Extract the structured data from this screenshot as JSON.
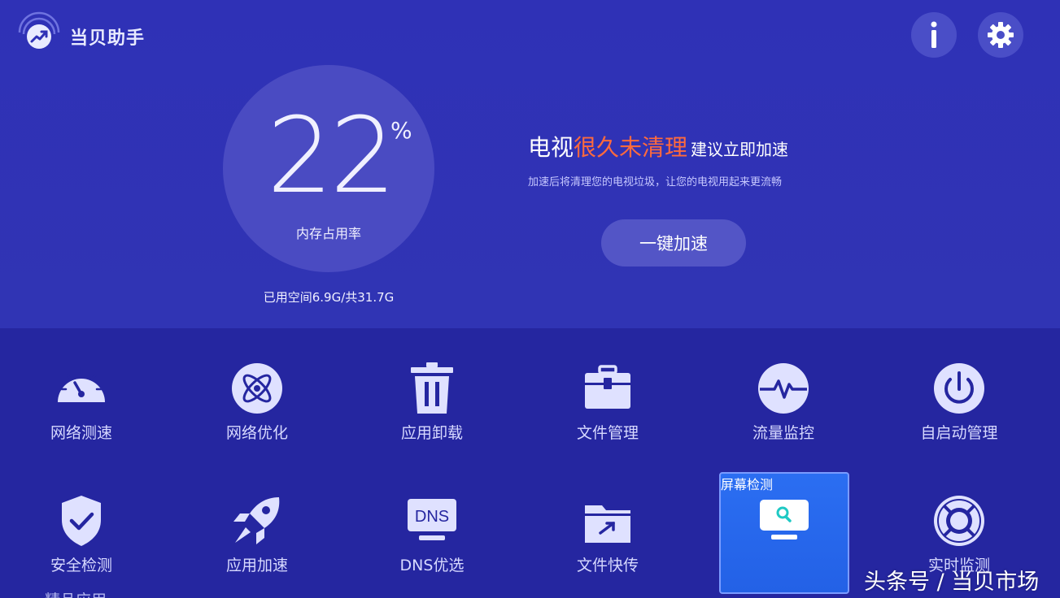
{
  "header": {
    "app_name": "当贝助手",
    "info_icon": "info-icon",
    "settings_icon": "gear-icon"
  },
  "memory": {
    "value": "22",
    "unit": "%",
    "label": "内存占用率",
    "storage": "已用空间6.9G/共31.7G"
  },
  "message": {
    "part1": "电视",
    "part2": "很久未清理",
    "part3": "建议立即加速",
    "subtitle": "加速后将清理您的电视垃圾，让您的电视用起来更流畅",
    "button": "一键加速"
  },
  "tools": {
    "row1": [
      {
        "label": "网络测速",
        "icon": "speedometer-icon"
      },
      {
        "label": "网络优化",
        "icon": "atom-icon"
      },
      {
        "label": "应用卸载",
        "icon": "trash-icon"
      },
      {
        "label": "文件管理",
        "icon": "toolbox-icon"
      },
      {
        "label": "流量监控",
        "icon": "pulse-icon"
      },
      {
        "label": "自启动管理",
        "icon": "power-icon"
      }
    ],
    "row2": [
      {
        "label": "安全检测",
        "icon": "shield-check-icon"
      },
      {
        "label": "应用加速",
        "icon": "rocket-icon"
      },
      {
        "label": "DNS优选",
        "icon": "dns-monitor-icon"
      },
      {
        "label": "文件快传",
        "icon": "folder-send-icon"
      },
      {
        "label": "屏幕检测",
        "icon": "monitor-search-icon"
      },
      {
        "label": "实时监测",
        "icon": "lifebuoy-icon"
      }
    ],
    "dns_icon_text": "DNS"
  },
  "partial_label": "精品应用",
  "watermark": "头条号 / 当贝市场",
  "colors": {
    "top_bg": "#2f31b6",
    "bottom_bg": "#2526a0",
    "accent_warn": "#ff6a3d",
    "selected_tile": "#2b6ef2"
  }
}
